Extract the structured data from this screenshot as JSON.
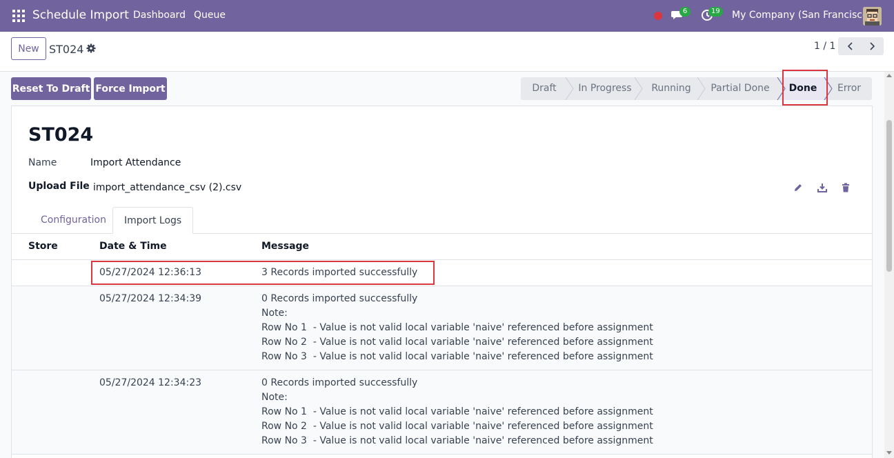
{
  "navbar": {
    "app_title": "Schedule Import",
    "links": [
      "Dashboard",
      "Queue"
    ],
    "chat_count": "6",
    "activity_count": "19",
    "company": "My Company (San Francisco)",
    "brand_color": "#71639e"
  },
  "control": {
    "new_label": "New",
    "record_name": "ST024",
    "pager": "1 / 1"
  },
  "statusbar": {
    "buttons": [
      "Reset To Draft",
      "Force Import"
    ],
    "stages": [
      "Draft",
      "In Progress",
      "Running",
      "Partial Done",
      "Done",
      "Error"
    ],
    "active_stage": "Done"
  },
  "form": {
    "title": "ST024",
    "name_label": "Name",
    "name_value": "Import Attendance",
    "upload_label": "Upload File",
    "upload_value": "import_attendance_csv (2).csv"
  },
  "tabs": [
    "Configuration",
    "Import Logs"
  ],
  "active_tab": "Import Logs",
  "logs": {
    "headers": [
      "Store",
      "Date & Time",
      "Message"
    ],
    "rows": [
      {
        "store": "",
        "datetime": "05/27/2024 12:36:13",
        "message": "3 Records imported successfully"
      },
      {
        "store": "",
        "datetime": "05/27/2024 12:34:39",
        "message": "0 Records imported successfully\nNote:\nRow No 1  - Value is not valid local variable 'naive' referenced before assignment\nRow No 2  - Value is not valid local variable 'naive' referenced before assignment\nRow No 3  - Value is not valid local variable 'naive' referenced before assignment"
      },
      {
        "store": "",
        "datetime": "05/27/2024 12:34:23",
        "message": "0 Records imported successfully\nNote:\nRow No 1  - Value is not valid local variable 'naive' referenced before assignment\nRow No 2  - Value is not valid local variable 'naive' referenced before assignment\nRow No 3  - Value is not valid local variable 'naive' referenced before assignment"
      }
    ]
  }
}
